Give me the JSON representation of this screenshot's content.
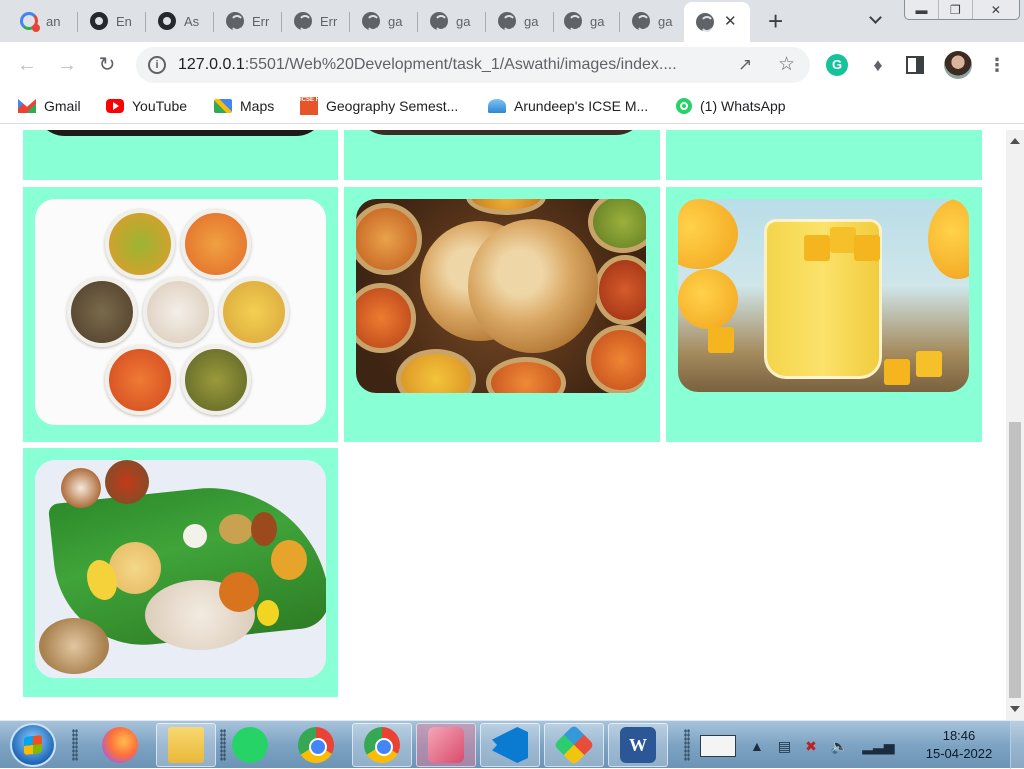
{
  "browser": {
    "tabs": [
      {
        "title": "an",
        "icon": "gmail-icon",
        "active": false
      },
      {
        "title": "En",
        "icon": "github-icon",
        "active": false
      },
      {
        "title": "As",
        "icon": "github-icon",
        "active": false
      },
      {
        "title": "Err",
        "icon": "globe-icon",
        "active": false
      },
      {
        "title": "Err",
        "icon": "globe-icon",
        "active": false
      },
      {
        "title": "ga",
        "icon": "globe-icon",
        "active": false
      },
      {
        "title": "ga",
        "icon": "globe-icon",
        "active": false
      },
      {
        "title": "ga",
        "icon": "globe-icon",
        "active": false
      },
      {
        "title": "ga",
        "icon": "globe-icon",
        "active": false
      },
      {
        "title": "ga",
        "icon": "globe-icon",
        "active": false
      },
      {
        "title": "",
        "icon": "globe-icon",
        "active": true
      }
    ],
    "new_tab_symbol": "+",
    "close_symbol": "✕",
    "url_host": "127.0.0.1",
    "url_path": ":5501/Web%20Development/task_1/Aswathi/images/index....",
    "bookmarks": [
      {
        "label": "Gmail",
        "icon": "gmail-icon"
      },
      {
        "label": "YouTube",
        "icon": "youtube-icon"
      },
      {
        "label": "Maps",
        "icon": "maps-icon"
      },
      {
        "label": "Geography Semest...",
        "icon": "icse-help-icon"
      },
      {
        "label": "Arundeep's ICSE M...",
        "icon": "arundeep-icon"
      },
      {
        "label": "(1) WhatsApp",
        "icon": "whatsapp-icon"
      }
    ],
    "icse_icon_text": "ICSE HELP"
  },
  "gallery": {
    "background_color": "#88ffd5",
    "images": [
      {
        "alt": "dark dish (partially visible)",
        "subject": "dark-dish"
      },
      {
        "alt": "dark dish (partially visible)",
        "subject": "dark-dish"
      },
      {
        "alt": "",
        "subject": "empty"
      },
      {
        "alt": "Seven curries and rice in white bowls",
        "subject": "curry-thali"
      },
      {
        "alt": "Naan with assorted Indian curries",
        "subject": "naan-curries"
      },
      {
        "alt": "Mango lassi in glass with mango cubes",
        "subject": "mango-lassi"
      },
      {
        "alt": "Kerala sadya on banana leaf",
        "subject": "sadya"
      }
    ]
  },
  "taskbar": {
    "apps": [
      "firefox-icon",
      "file-explorer-icon",
      "whatsapp-icon",
      "chrome-icon",
      "chrome-profile-icon",
      "snipping-tool-icon",
      "vscode-icon",
      "paint-icon",
      "word-icon"
    ],
    "word_letter": "W",
    "time": "18:46",
    "date": "15-04-2022"
  }
}
